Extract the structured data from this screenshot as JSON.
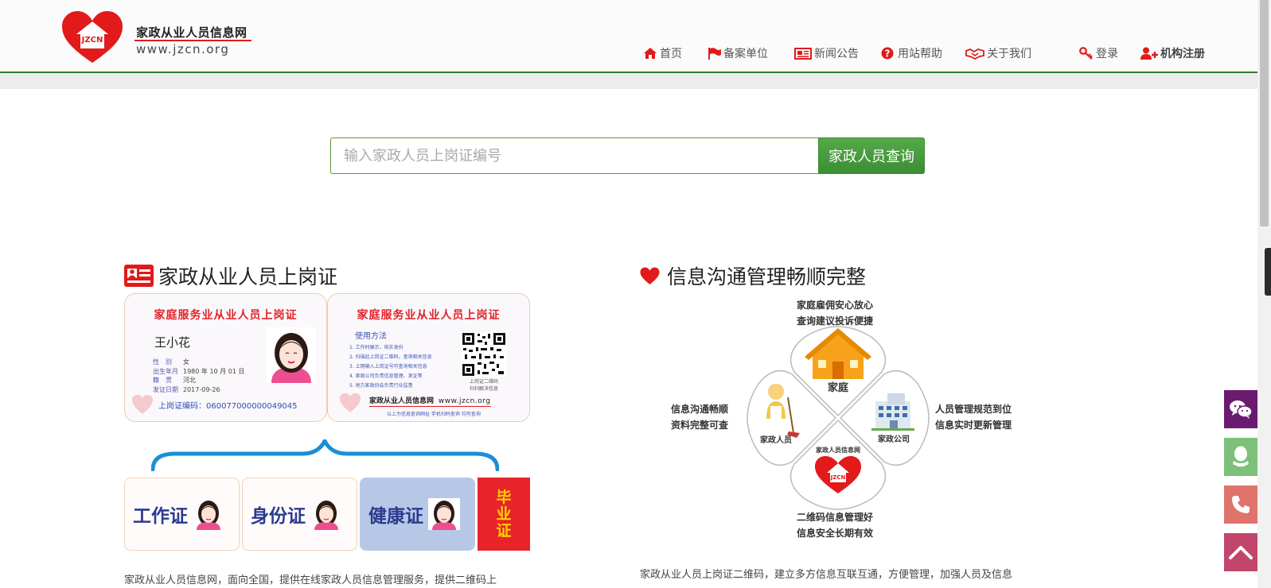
{
  "header": {
    "logo_text": "JZCN",
    "site_name": "家政从业人员信息网",
    "site_url": "www.jzcn.org"
  },
  "nav": {
    "home": "首页",
    "registered_units": "备案单位",
    "news": "新闻公告",
    "help": "用站帮助",
    "about": "关于我们",
    "login": "登录",
    "org_register": "机构注册"
  },
  "search": {
    "placeholder": "输入家政人员上岗证编号",
    "button": "家政人员查询"
  },
  "left": {
    "title": "家政从业人员上岗证",
    "card_front": {
      "heading": "家庭服务业从业人员上岗证",
      "name": "王小花",
      "fields": [
        {
          "label": "性　别",
          "value": "女"
        },
        {
          "label": "出生年月",
          "value": "1980 年 10 月 01 日"
        },
        {
          "label": "籍　贯",
          "value": "河北"
        },
        {
          "label": "发证日期",
          "value": "2017-09-26"
        }
      ],
      "code_label": "上岗证编码：060077000000049045"
    },
    "card_back": {
      "heading": "家庭服务业从业人员上岗证",
      "usage_title": "使用方法",
      "usage_items": [
        "1. 工作时展示，核实身份",
        "2. 扫描此上岗证二维码，查询相关信息",
        "3. 上网输入上岗证号可查询相关信息",
        "4. 家政公司负责信息管理、发证等",
        "5. 地方家政协会负责行业监督"
      ],
      "qr_caption_1": "上岗证二维码",
      "qr_caption_2": "扫扫解决信息",
      "footer_name": "家政从业人员信息网",
      "footer_url": "www.jzcn.org",
      "footer_note": "以上为信息查询网址 手机扫码查询 均可查询"
    },
    "mini_cards": [
      "工作证",
      "身份证",
      "健康证"
    ],
    "grad_card": "毕业证",
    "paragraph": "家政从业人员信息网，面向全国，提供在线家政人员信息管理服务，提供二维码上"
  },
  "right": {
    "title": "信息沟通管理畅顺完整",
    "top_text": [
      "家庭雇佣安心放心",
      "查询建议投诉便捷"
    ],
    "left_text": [
      "信息沟通畅顺",
      "资料完整可查"
    ],
    "right_text": [
      "人员管理规范到位",
      "信息实时更新管理"
    ],
    "bottom_text": [
      "二维码信息管理好",
      "信息安全长期有效"
    ],
    "petal_labels": {
      "top": "家庭",
      "left": "家政人员",
      "right": "家政公司",
      "bottom_title": "家政人员信息网",
      "bottom_logo": "JZCN"
    },
    "paragraph": "家政从业人员上岗证二维码，建立多方信息互联互通，方便管理，加强人员及信息"
  },
  "colors": {
    "brand_red": "#e21a1a",
    "header_border": "#2f7d2f",
    "search_button": "#4a9c3f",
    "wechat": "#6a1b6f",
    "qq": "#7cc07a",
    "phone": "#e0736b",
    "top": "#c2456b"
  },
  "side_icons": [
    "wechat-icon",
    "qq-icon",
    "phone-icon",
    "back-to-top-icon"
  ]
}
